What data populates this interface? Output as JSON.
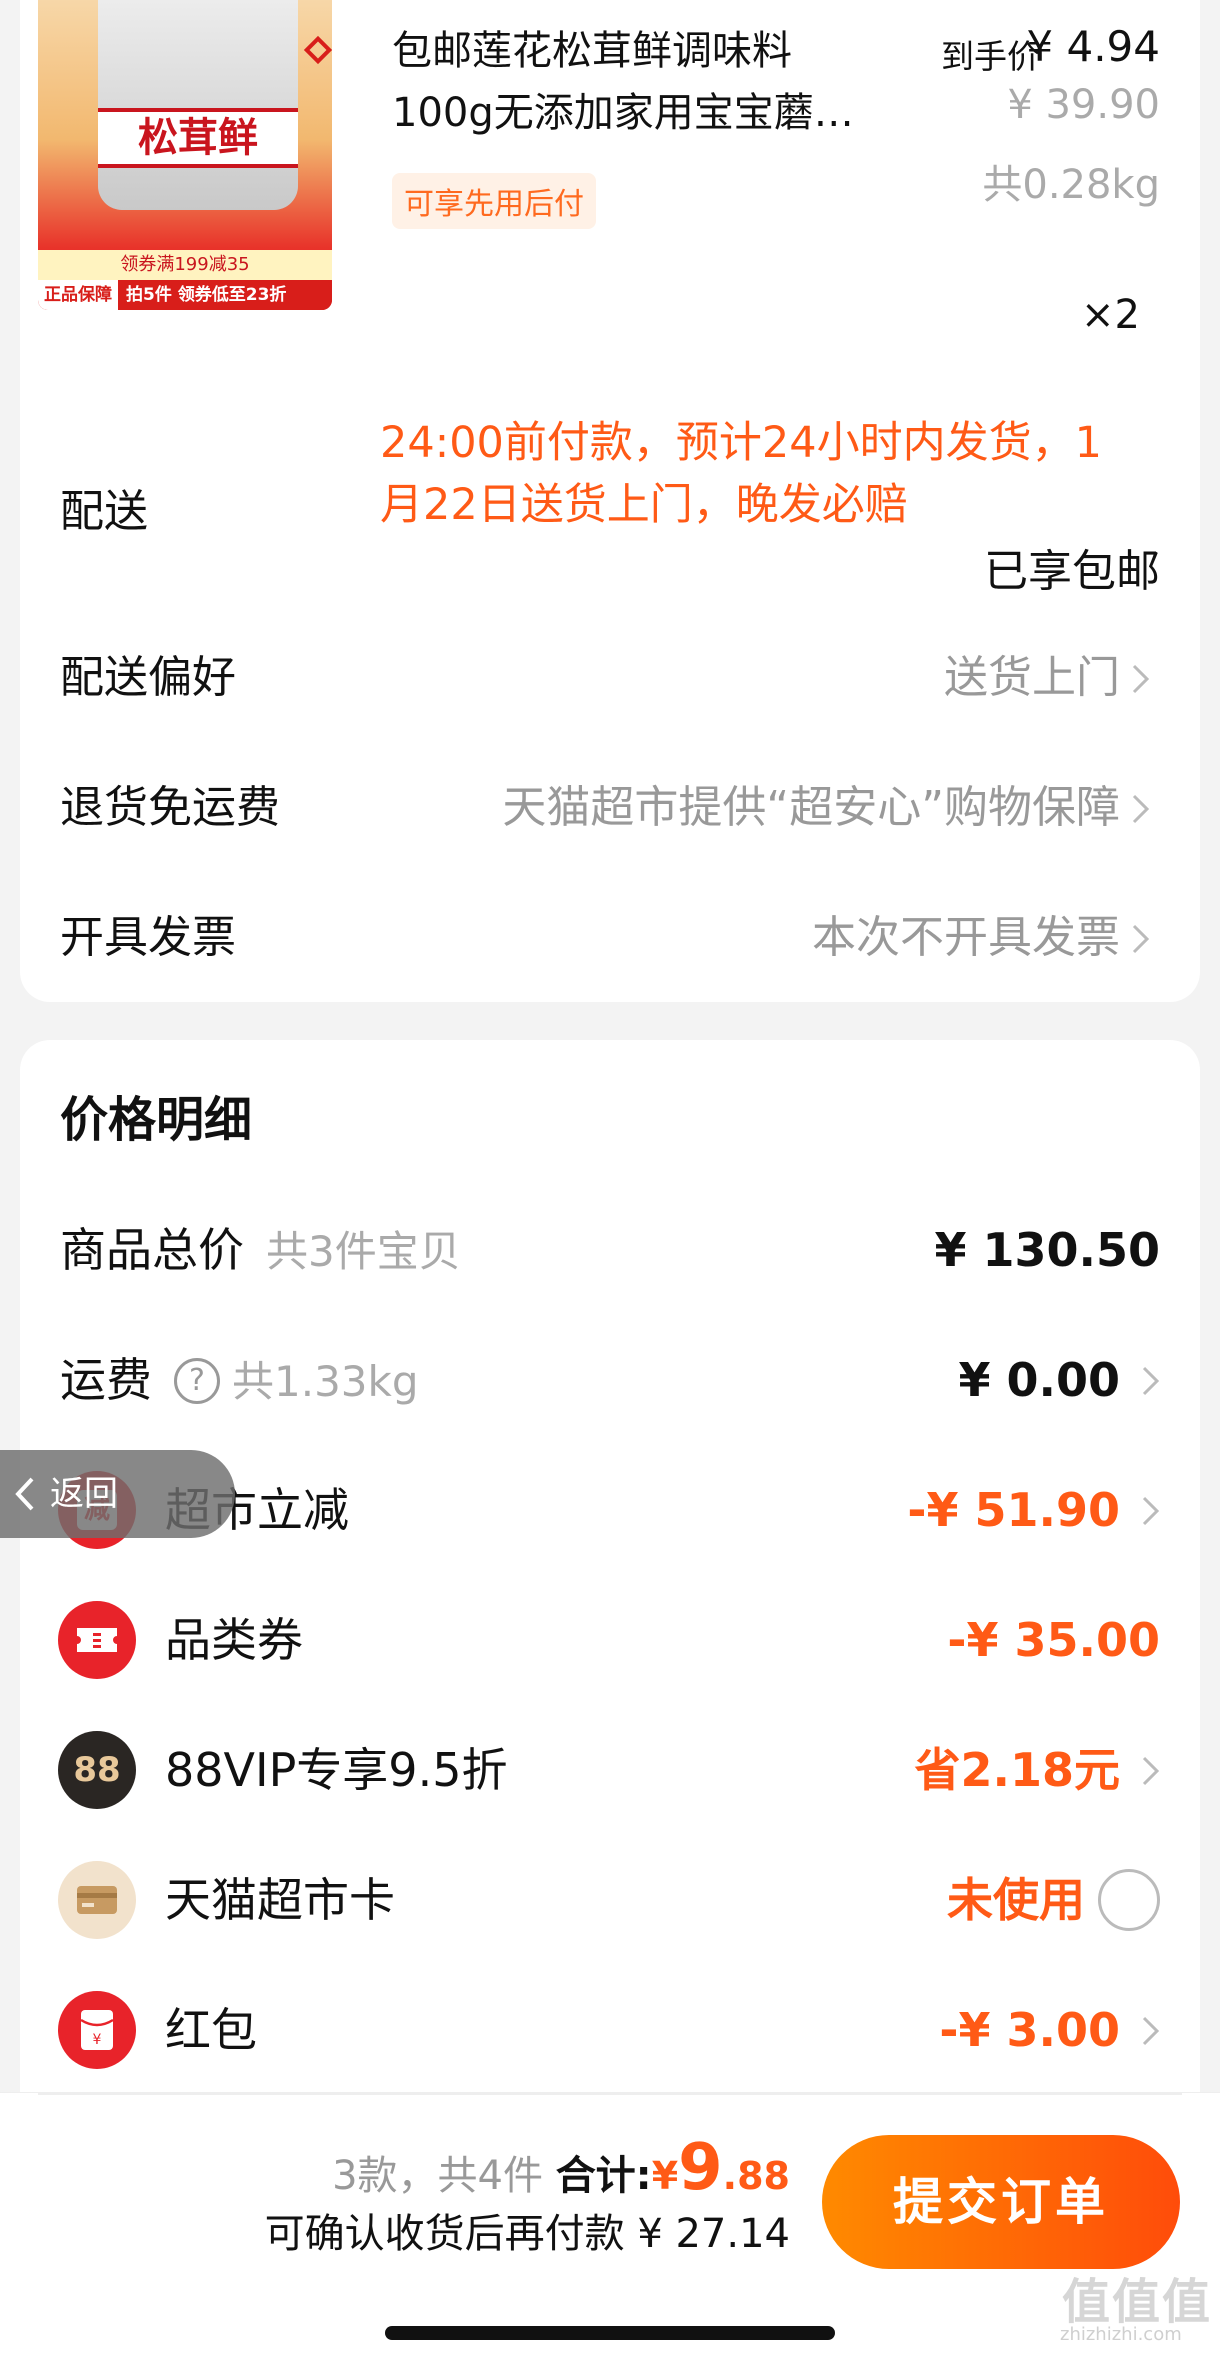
{
  "product": {
    "title_line1": "包邮莲花松茸鲜调味料",
    "title_line2": "100g无添加家用宝宝蘑…",
    "image_jar_text": "松茸鲜",
    "image_banner": "领券满199减35",
    "image_badge": "正品保障",
    "image_strip": "拍5件 领券低至23折",
    "final_price_label": "到手价",
    "final_price": "¥ 4.94",
    "original_price": "¥ 39.90",
    "weight": "共0.28kg",
    "paylater_tag": "可享先用后付",
    "quantity": "×2"
  },
  "delivery": {
    "label": "配送",
    "note": "24:00前付款，预计24小时内发货，1月22日送货上门，晚发必赔",
    "free_shipping": "已享包邮"
  },
  "options": [
    {
      "label": "配送偏好",
      "value": "送货上门"
    },
    {
      "label": "退货免运费",
      "value": "天猫超市提供“超安心”购物保障"
    },
    {
      "label": "开具发票",
      "value": "本次不开具发票"
    }
  ],
  "price_detail": {
    "title": "价格明细",
    "subtotal_label": "商品总价",
    "subtotal_sub": "共3件宝贝",
    "subtotal_value": "¥ 130.50",
    "shipping_label": "运费",
    "shipping_sub": "共1.33kg",
    "shipping_value": "¥ 0.00",
    "discounts": [
      {
        "label": "超市立减",
        "value": "-¥ 51.90",
        "icon": "discount-icon",
        "color": "#e8232a"
      },
      {
        "label": "品类券",
        "value": "-¥ 35.00",
        "icon": "ticket-icon",
        "color": "#e8232a"
      },
      {
        "label": "88VIP专享9.5折",
        "value": "省2.18元",
        "icon": "88vip-icon",
        "color": "#2a2623"
      },
      {
        "label": "天猫超市卡",
        "value": "未使用",
        "icon": "card-icon",
        "color": "#f2e2cc"
      },
      {
        "label": "红包",
        "value": "-¥ 3.00",
        "icon": "red-envelope-icon",
        "color": "#e8232a"
      }
    ],
    "icon_text": {
      "discount": "减",
      "vip": "88"
    }
  },
  "back_button": {
    "label": "返回"
  },
  "summary": {
    "counts": "3款，共4件",
    "total_label": "合计:",
    "currency": "¥",
    "total_int": "9",
    "total_dec": ".88",
    "pay_later": "可确认收货后再付款 ¥ 27.14",
    "submit_label": "提交订单"
  },
  "watermark": {
    "text": "值值值",
    "url": "zhizhizhi.com"
  },
  "colors": {
    "accent": "#ff5a16",
    "muted": "#999999"
  }
}
